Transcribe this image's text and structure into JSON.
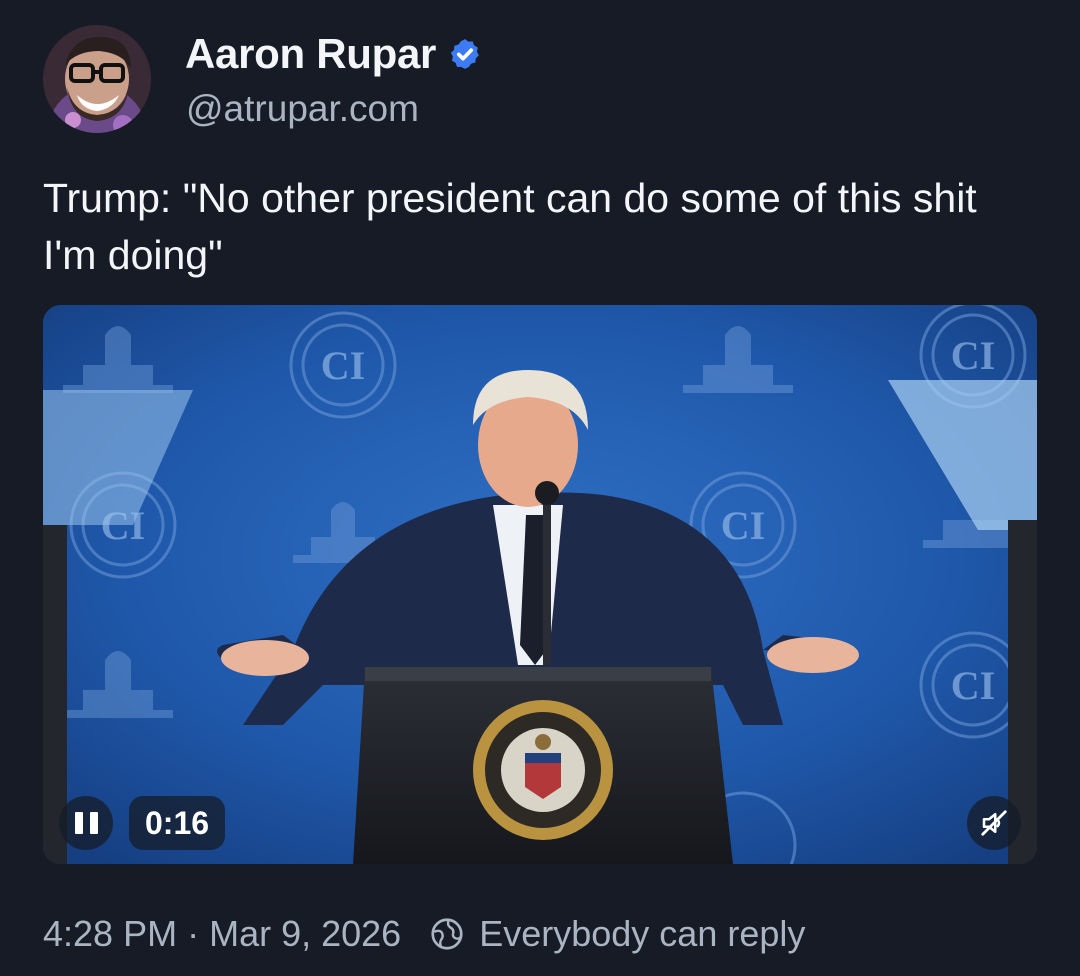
{
  "author": {
    "display_name": "Aaron Rupar",
    "handle": "@atrupar.com",
    "verified": true,
    "avatar_icon": "avatar"
  },
  "post": {
    "text": "Trump: \"No other president can do some of this shit I'm doing\""
  },
  "video": {
    "elapsed": "0:16",
    "state": "playing",
    "muted": true,
    "backdrop_logo_text": "CI",
    "seal_text": "SEAL OF THE PRESIDENT OF THE UNITED STATES"
  },
  "meta": {
    "time": "4:28 PM",
    "separator": "·",
    "date": "Mar 9, 2026",
    "reply_setting": "Everybody can reply"
  },
  "colors": {
    "background": "#161b26",
    "accent_blue": "#3d7bf5",
    "muted_text": "#aab4c3",
    "backdrop_blue": "#1d4f9a"
  }
}
